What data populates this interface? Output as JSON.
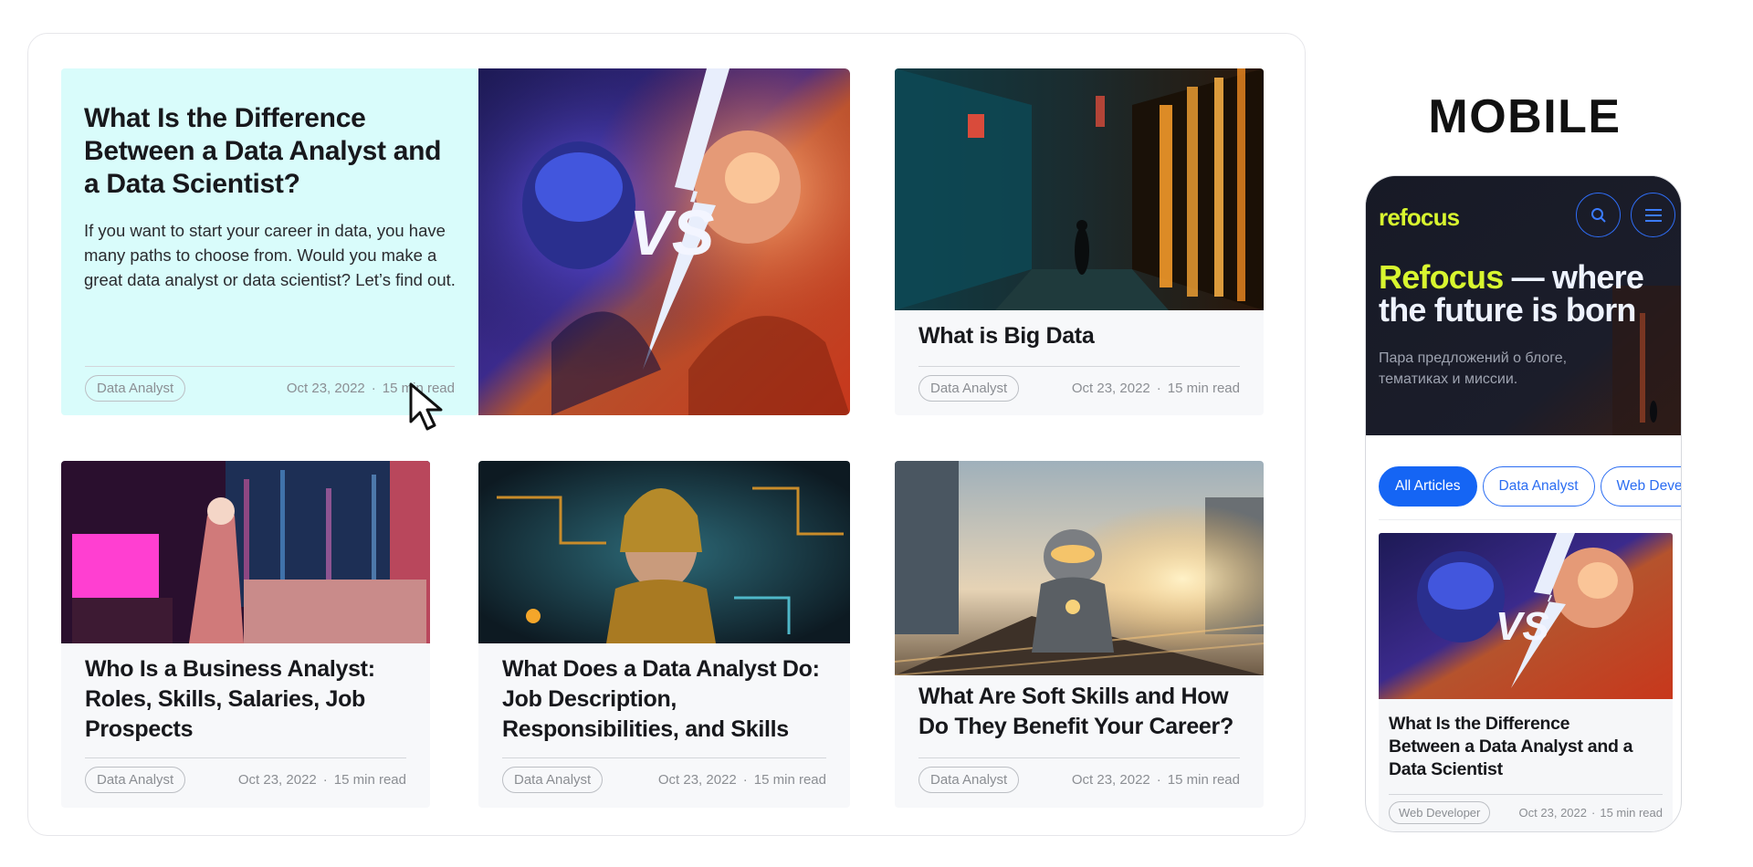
{
  "featured": {
    "title": "What Is the Difference Between a Data Analyst and a Data Scientist?",
    "excerpt": "If you want to start your career in data, you have many paths to choose from. Would you make a great data analyst or data scientist? Let’s find out.",
    "tag": "Data Analyst",
    "date": "Oct 23, 2022",
    "read_time": "15 min read",
    "image_overlay": "VS"
  },
  "articles": [
    {
      "title": "What is Big Data",
      "tag": "Data Analyst",
      "date": "Oct 23, 2022",
      "read_time": "15 min read"
    },
    {
      "title": "Who Is a Business Analyst: Roles, Skills, Salaries, Job Prospects",
      "tag": "Data Analyst",
      "date": "Oct 23, 2022",
      "read_time": "15 min read"
    },
    {
      "title": "What Does a Data Analyst Do: Job Description, Responsibilities, and Skills",
      "tag": "Data Analyst",
      "date": "Oct 23, 2022",
      "read_time": "15 min read"
    },
    {
      "title": "What Are Soft Skills and How Do They Benefit Your Career?",
      "tag": "Data Analyst",
      "date": "Oct 23, 2022",
      "read_time": "15 min read"
    }
  ],
  "mobile_label": "MOBILE",
  "mobile": {
    "logo": "refocus",
    "hero_title_accent": "Refocus",
    "hero_title_rest": " — where the future is born",
    "hero_subtitle": "Пара предложений о блоге, тематиках и миссии.",
    "chips": [
      "All Articles",
      "Data Analyst",
      "Web Developer"
    ],
    "card": {
      "title": "What Is the Difference Between a Data Analyst and a Data Scientist",
      "tag": "Web Developer",
      "date": "Oct 23, 2022",
      "read_time": "15 min read",
      "image_overlay": "VS"
    }
  },
  "colors": {
    "featured_bg": "#d9fcfb",
    "accent_blue": "#1565f4",
    "logo_lime": "#d8f62f",
    "hero_bg": "#151822"
  },
  "icons": [
    "cursor-arrow-icon",
    "search-icon",
    "menu-icon"
  ]
}
